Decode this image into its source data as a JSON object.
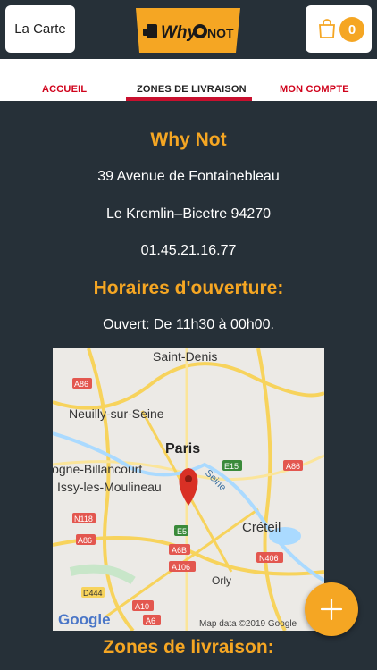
{
  "header": {
    "carte_label": "La Carte",
    "logo_text_why": "Why",
    "logo_text_not": "NOT",
    "cart_count": "0"
  },
  "tabs": [
    {
      "label": "ACCUEIL"
    },
    {
      "label": "ZONES DE LIVRAISON"
    },
    {
      "label": "MON COMPTE"
    }
  ],
  "restaurant": {
    "name": "Why Not",
    "address_line1": "39 Avenue de Fontainebleau",
    "address_line2": "Le Kremlin–Bicetre 94270",
    "phone": "01.45.21.16.77"
  },
  "hours": {
    "title": "Horaires d'ouverture:",
    "text": "Ouvert: De 11h30 à 00h00."
  },
  "map": {
    "labels": [
      "Saint-Denis",
      "A86",
      "Neuilly-sur-Seine",
      "Paris",
      "logne-Billancourt",
      "Issy-les-Moulineau",
      "E15",
      "A86",
      "Seine",
      "N118",
      "E5",
      "Créteil",
      "A86",
      "A6B",
      "N406",
      "A106",
      "Orly",
      "D444",
      "A10",
      "A6"
    ],
    "google": "Google",
    "attribution": "Map data ©2019 Google"
  },
  "zones": {
    "title": "Zones de livraison:"
  },
  "colors": {
    "accent": "#f5a623",
    "background": "#263038",
    "tab_red": "#d0021b"
  }
}
